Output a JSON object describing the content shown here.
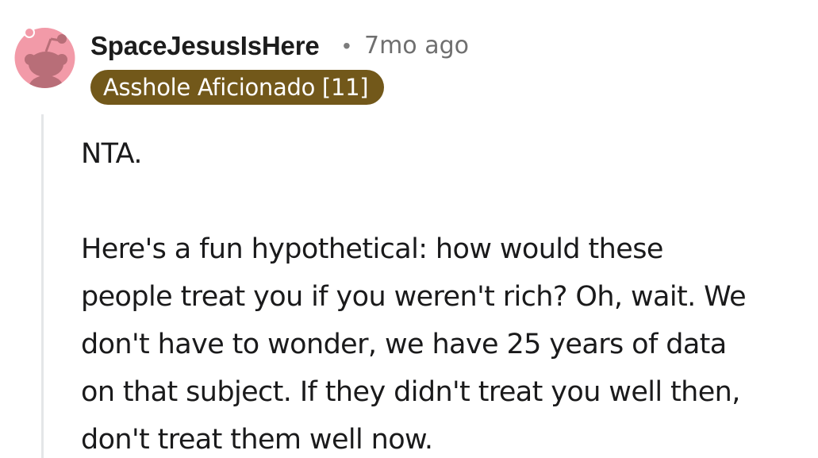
{
  "comment": {
    "author": "SpaceJesusIsHere",
    "separator": "•",
    "timestamp": "7mo ago",
    "flair": "Asshole Aficionado [11]",
    "paragraphs": [
      "NTA.",
      "Here's a fun hypothetical: how would these",
      "people treat you if you weren't rich? Oh, wait. We",
      "don't have to wonder, we have 25 years of data",
      "on that subject. If they didn't treat you well then,",
      "don't treat them well now."
    ]
  },
  "colors": {
    "flair_bg": "#72581a",
    "avatar_bg": "#f29aa8",
    "thread_line": "#e4e6e8"
  },
  "icons": {
    "avatar": "snoo-avatar-icon"
  }
}
